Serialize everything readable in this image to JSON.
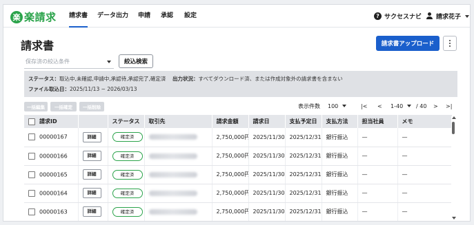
{
  "brand": {
    "logo_char": "楽",
    "logo_text": "楽請求"
  },
  "nav": {
    "items": [
      {
        "label": "請求書",
        "active": true
      },
      {
        "label": "データ出力"
      },
      {
        "label": "申請"
      },
      {
        "label": "承認"
      },
      {
        "label": "設定"
      }
    ],
    "help_label": "サクセスナビ",
    "user_label": "請求花子"
  },
  "page": {
    "title": "請求書",
    "upload_label": "請求書アップロード",
    "saved_filter_placeholder": "保存済の絞込条件",
    "filter_button": "絞込検索"
  },
  "summary": {
    "status_label": "ステータス：",
    "status_value": "取込中,未確認,申請中,承認待,承認完了,確定済",
    "output_label": "出力状況：",
    "output_value": "すべてダウンロード済、または作成対象外の請求書を含まない",
    "import_label": "ファイル取込日：",
    "import_value": "2025/11/13 ~ 2026/03/13"
  },
  "bulk_actions": [
    "一括編集",
    "一括確定",
    "一括削除"
  ],
  "pager": {
    "per_page_label": "表示件数",
    "per_page_value": "100",
    "range": "1-40",
    "total": "/ 40",
    "first": "|<",
    "prev": "<",
    "next": ">",
    "last": ">|"
  },
  "table": {
    "columns": [
      "請求ID",
      "",
      "ステータス",
      "取引先",
      "請求金額",
      "請求日",
      "支払予定日",
      "支払方法",
      "担当社員",
      "メモ"
    ],
    "detail_label": "詳細",
    "rows": [
      {
        "id": "00000167",
        "status": "確定済",
        "amount": "2,750,000円",
        "invoice_date": "2025/11/30",
        "due_date": "2025/12/31",
        "method": "銀行振込",
        "staff": "—",
        "memo": "—"
      },
      {
        "id": "00000166",
        "status": "確定済",
        "amount": "2,750,000円",
        "invoice_date": "2025/11/30",
        "due_date": "2025/12/31",
        "method": "銀行振込",
        "staff": "—",
        "memo": "—"
      },
      {
        "id": "00000165",
        "status": "確定済",
        "amount": "2,750,000円",
        "invoice_date": "2025/11/30",
        "due_date": "2025/12/31",
        "method": "銀行振込",
        "staff": "—",
        "memo": "—"
      },
      {
        "id": "00000164",
        "status": "確定済",
        "amount": "2,750,000円",
        "invoice_date": "2025/11/30",
        "due_date": "2025/12/31",
        "method": "銀行振込",
        "staff": "—",
        "memo": "—"
      },
      {
        "id": "00000163",
        "status": "確定済",
        "amount": "2,750,000円",
        "invoice_date": "2025/11/30",
        "due_date": "2025/12/31",
        "method": "銀行振込",
        "staff": "—",
        "memo": "—"
      }
    ]
  },
  "colors": {
    "brand": "#2aa34a",
    "primary": "#1a5fcc"
  }
}
